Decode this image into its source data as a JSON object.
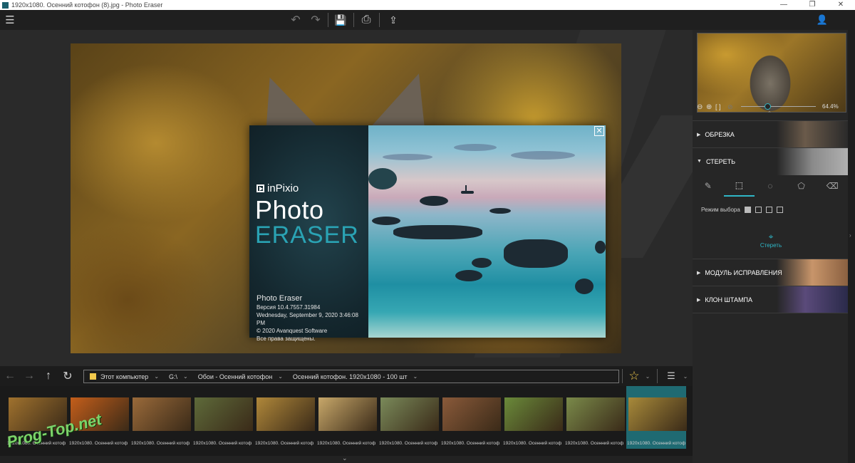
{
  "window": {
    "title": "1920x1080. Осенний котофон (8).jpg - Photo Eraser",
    "minimize": "—",
    "maximize": "❐",
    "close": "✕"
  },
  "toolbar": {
    "menu_icon": "☰",
    "undo_icon": "↶",
    "redo_icon": "↷",
    "save_icon": "💾",
    "print_icon": "⎙",
    "share_icon": "⇪",
    "user_icon": "👤"
  },
  "splash": {
    "brand": "inPixio",
    "word1": "Photo",
    "word2": "ERASER",
    "product": "Photo Eraser",
    "version": "Версия 10.4.7557.31984",
    "date": "Wednesday, September 9, 2020 3:46:08 PM",
    "copyright": "© 2020 Avanquest Software",
    "rights": "Все права защищены.",
    "close_icon": "✕"
  },
  "nav": {
    "back_icon": "←",
    "forward_icon": "→",
    "up_icon": "↑",
    "refresh_icon": "↻",
    "crumbs": [
      "Этот компьютер",
      "G:\\",
      "Обои - Осенний котофон",
      "Осенний котофон. 1920x1080 - 100 шт"
    ],
    "star_icon": "☆",
    "sort_icon": "☰"
  },
  "thumbnails": [
    {
      "label": "1920x1080. Осенний котоф",
      "color": "#a0722e"
    },
    {
      "label": "1920x1080. Осенний котоф",
      "color": "#c45e1a"
    },
    {
      "label": "1920x1080. Осенний котоф",
      "color": "#9a6a3a"
    },
    {
      "label": "1920x1080. Осенний котоф",
      "color": "#5e6a3a"
    },
    {
      "label": "1920x1080. Осенний котоф",
      "color": "#b0883a"
    },
    {
      "label": "1920x1080. Осенний котоф",
      "color": "#c8a86a"
    },
    {
      "label": "1920x1080. Осенний котоф",
      "color": "#7a8a5a"
    },
    {
      "label": "1920x1080. Осенний котоф",
      "color": "#8a5a3a"
    },
    {
      "label": "1920x1080. Осенний котоф",
      "color": "#6a8a3a"
    },
    {
      "label": "1920x1080. Осенний котоф",
      "color": "#7a8a4a"
    },
    {
      "label": "1920x1080. Осенний котоф",
      "color": "#a88a3a"
    }
  ],
  "watermark": "Prog-Top.net",
  "panel": {
    "zoom_value": "64.4%",
    "zoom_fraction": 0.644,
    "sections": {
      "crop": "ОБРЕЗКА",
      "erase": "СТЕРЕТЬ",
      "fix": "МОДУЛЬ ИСПРАВЛЕНИЯ",
      "clone": "КЛОН ШТАМПА"
    },
    "mode_label": "Режим выбора",
    "erase_button": "Стереть"
  },
  "colors": {
    "accent": "#2fb7c7",
    "eraser_text": "#2aa3b4"
  }
}
